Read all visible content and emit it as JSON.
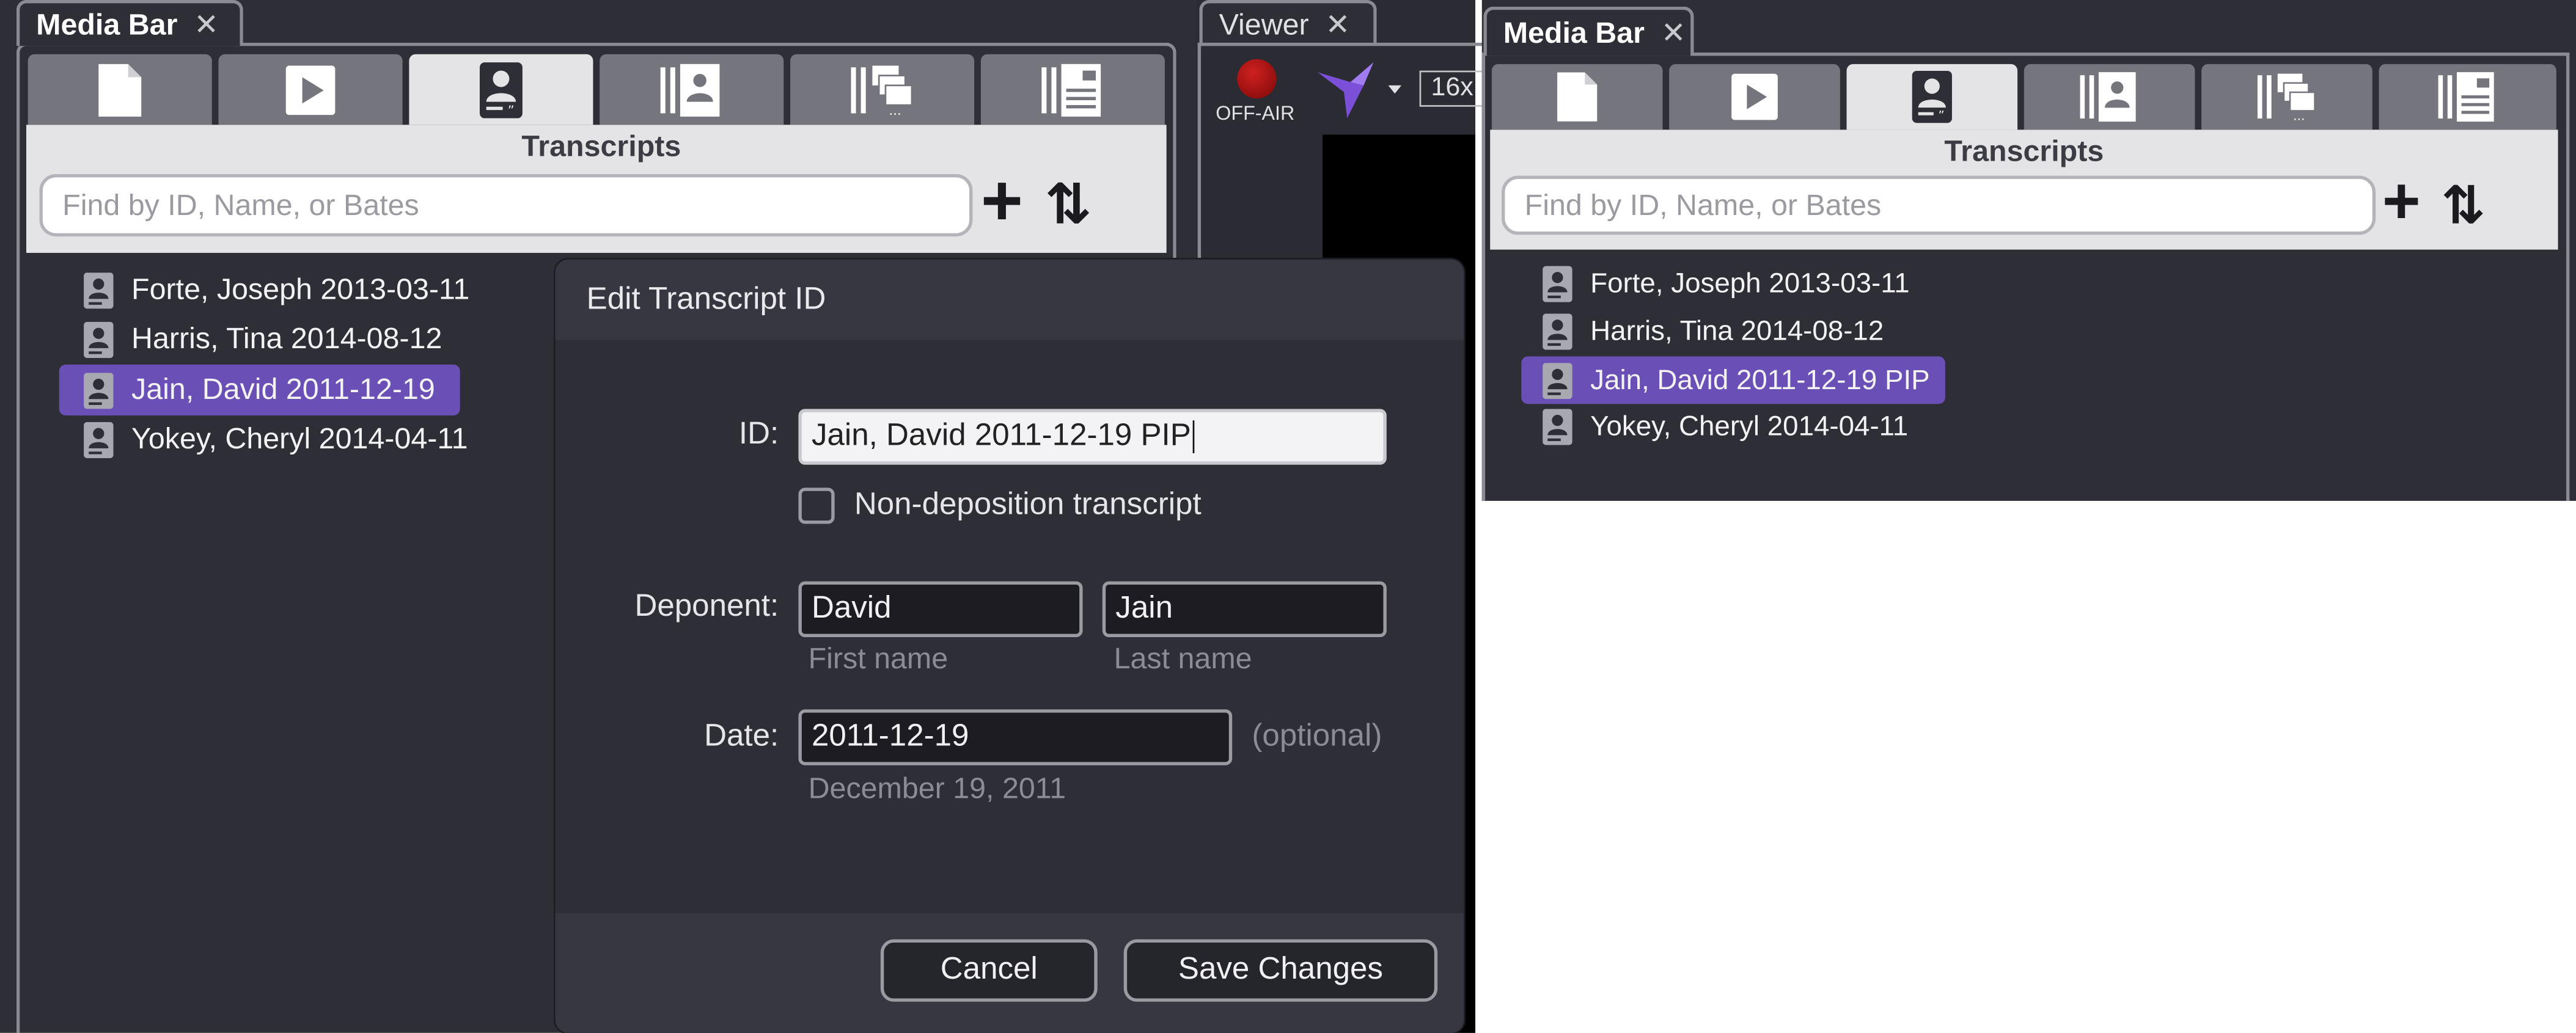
{
  "left_panel": {
    "title": "Media Bar",
    "close_glyph": "✕",
    "tabs": [
      {
        "icon": "document-icon",
        "active": false
      },
      {
        "icon": "play-icon",
        "active": false
      },
      {
        "icon": "transcript-icon",
        "active": true
      },
      {
        "icon": "exhibit-list-icon",
        "active": false
      },
      {
        "icon": "clips-icon",
        "active": false
      },
      {
        "icon": "notebook-icon",
        "active": false
      }
    ],
    "section_title": "Transcripts",
    "search_placeholder": "Find by ID, Name, or Bates",
    "add_glyph": "+",
    "sort_glyph": "⇅",
    "items": [
      {
        "label": "Forte, Joseph 2013-03-11",
        "selected": false
      },
      {
        "label": "Harris, Tina 2014-08-12",
        "selected": false
      },
      {
        "label": "Jain, David 2011-12-19",
        "selected": true
      },
      {
        "label": "Yokey, Cheryl 2014-04-11",
        "selected": false
      }
    ]
  },
  "viewer": {
    "title": "Viewer",
    "close_glyph": "✕",
    "status": "OFF-AIR",
    "zoom": "16x"
  },
  "dialog": {
    "title": "Edit Transcript ID",
    "id_label": "ID:",
    "id_value": "Jain, David 2011-12-19 PIP",
    "checkbox_label": "Non-deposition transcript",
    "checkbox_checked": false,
    "deponent_label": "Deponent:",
    "first_name": "David",
    "last_name": "Jain",
    "first_name_hint": "First name",
    "last_name_hint": "Last name",
    "date_label": "Date:",
    "date_value": "2011-12-19",
    "date_optional": "(optional)",
    "date_display": "December 19, 2011",
    "cancel_label": "Cancel",
    "save_label": "Save Changes"
  },
  "right_panel": {
    "title": "Media Bar",
    "close_glyph": "✕",
    "section_title": "Transcripts",
    "search_placeholder": "Find by ID, Name, or Bates",
    "add_glyph": "+",
    "sort_glyph": "⇅",
    "items": [
      {
        "label": "Forte, Joseph 2013-03-11",
        "selected": false
      },
      {
        "label": "Harris, Tina 2014-08-12",
        "selected": false
      },
      {
        "label": "Jain, David 2011-12-19 PIP",
        "selected": true
      },
      {
        "label": "Yokey, Cheryl 2014-04-11",
        "selected": false
      }
    ]
  },
  "colors": {
    "panel_bg": "#2e2e37",
    "accent_selected": "#6a4fb6",
    "tab_inactive": "#75757d",
    "tab_active": "#e4e4e7",
    "status_red": "#8f1010",
    "logo_purple": "#7b4fd8"
  }
}
